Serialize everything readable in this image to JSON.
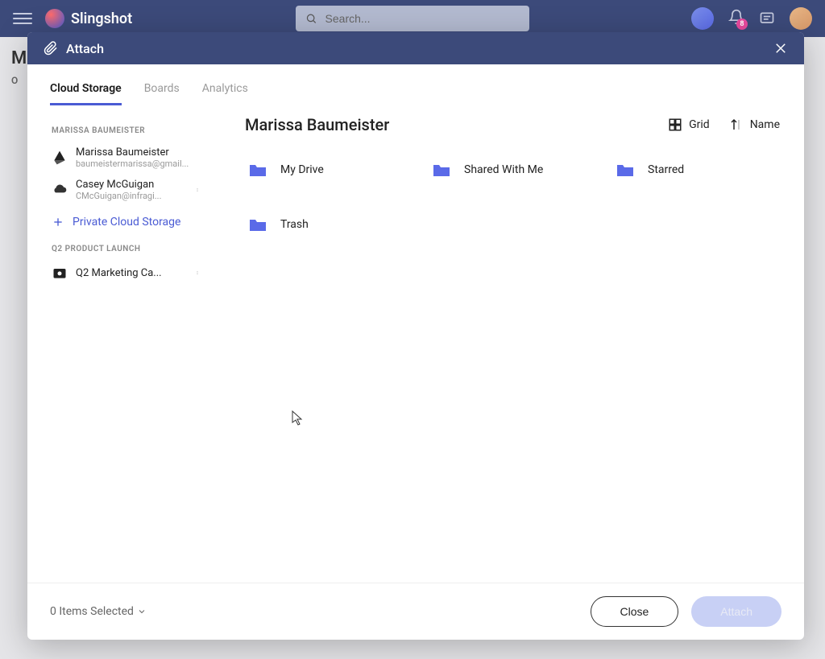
{
  "topbar": {
    "brand": "Slingshot",
    "search_placeholder": "Search...",
    "notification_count": "8"
  },
  "bg": {
    "title_prefix": "M",
    "sub_prefix": "O"
  },
  "modal": {
    "title": "Attach",
    "tabs": [
      {
        "label": "Cloud Storage",
        "active": true
      },
      {
        "label": "Boards",
        "active": false
      },
      {
        "label": "Analytics",
        "active": false
      }
    ],
    "sidebar": {
      "section1_heading": "MARISSA BAUMEISTER",
      "accounts": [
        {
          "name": "Marissa Baumeister",
          "email": "baumeistermarissa@gmail...",
          "provider": "gdrive"
        },
        {
          "name": "Casey McGuigan",
          "email": "CMcGuigan@infragi...",
          "provider": "onedrive"
        }
      ],
      "add_storage_label": "Private Cloud Storage",
      "section2_heading": "Q2 PRODUCT LAUNCH",
      "items": [
        {
          "name": "Q2 Marketing Ca..."
        }
      ]
    },
    "main": {
      "title": "Marissa Baumeister",
      "view_label": "Grid",
      "sort_label": "Name",
      "folders": [
        {
          "name": "My Drive"
        },
        {
          "name": "Shared With Me"
        },
        {
          "name": "Starred"
        },
        {
          "name": "Trash"
        }
      ]
    },
    "footer": {
      "selected_text": "0 Items Selected",
      "close_label": "Close",
      "attach_label": "Attach"
    }
  },
  "colors": {
    "primary": "#3c4a7a",
    "accent": "#4a5bd4",
    "folder": "#5a6ae8"
  }
}
